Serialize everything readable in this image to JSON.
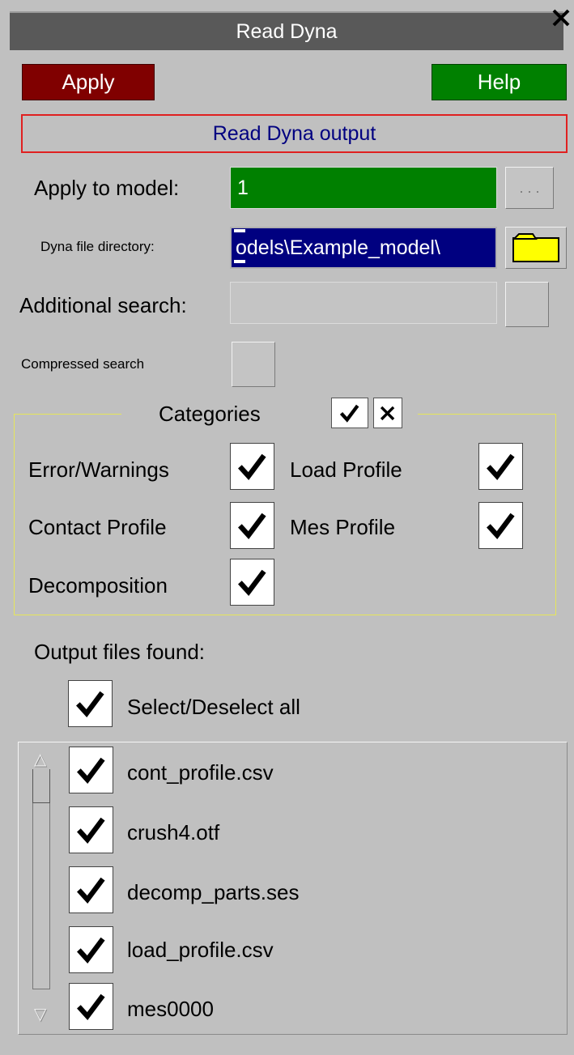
{
  "window": {
    "title": "Read Dyna",
    "close_glyph": "✕",
    "close_icon": "close-icon"
  },
  "toolbar": {
    "apply_label": "Apply",
    "help_label": "Help",
    "apply_color": "#800000",
    "help_color": "#008000"
  },
  "header": {
    "text": "Read Dyna output",
    "border_color": "#e02020",
    "text_color": "#000080"
  },
  "fields": {
    "apply_model_label": "Apply to model:",
    "apply_model_value": "1",
    "apply_model_button": ". . .",
    "apply_model_bg": "#008000",
    "dir_label": "Dyna file directory:",
    "dir_value": "odels\\Example_model\\",
    "dir_bg": "#000080",
    "dir_icon": "folder-icon",
    "folder_color": "#ffff00",
    "additional_label": "Additional search:",
    "additional_value": "",
    "compressed_label": "Compressed search",
    "compressed_checked": false
  },
  "categories": {
    "title": "Categories",
    "select_all_icon": "checkmark-icon",
    "deselect_all_glyph": "✕",
    "deselect_all_icon": "close-icon",
    "items": [
      {
        "label": "Error/Warnings",
        "checked": true
      },
      {
        "label": "Load Profile",
        "checked": true
      },
      {
        "label": "Contact Profile",
        "checked": true
      },
      {
        "label": "Mes Profile",
        "checked": true
      },
      {
        "label": "Decomposition",
        "checked": true
      }
    ]
  },
  "output": {
    "label": "Output files found:",
    "select_all_label": "Select/Deselect all",
    "select_all_checked": true,
    "scroll_up_glyph": "△",
    "scroll_down_glyph": "▽",
    "files": [
      {
        "name": "cont_profile.csv",
        "checked": true
      },
      {
        "name": "crush4.otf",
        "checked": true
      },
      {
        "name": "decomp_parts.ses",
        "checked": true
      },
      {
        "name": "load_profile.csv",
        "checked": true
      },
      {
        "name": "mes0000",
        "checked": true
      }
    ]
  }
}
